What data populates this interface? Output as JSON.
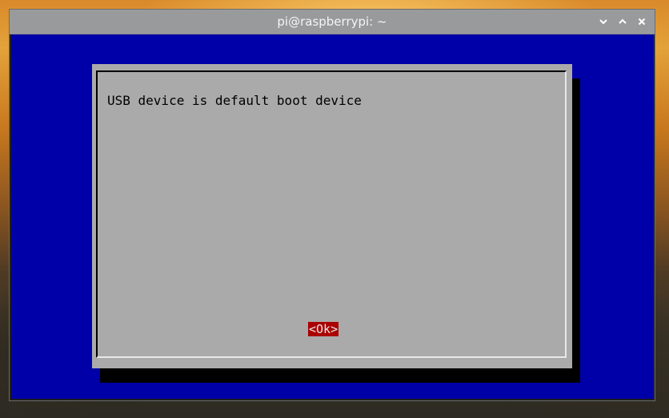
{
  "window": {
    "title": "pi@raspberrypi: ~",
    "controls": {
      "minimize_icon": "chevron-down-icon",
      "maximize_icon": "chevron-up-icon",
      "close_icon": "close-icon"
    }
  },
  "dialog": {
    "message": "USB device is default boot device",
    "ok_label": "<Ok>"
  },
  "colors": {
    "terminal_background": "#0000a8",
    "dialog_background": "#aaaaaa",
    "button_highlight": "#aa0000",
    "titlebar": "#999a9c"
  }
}
